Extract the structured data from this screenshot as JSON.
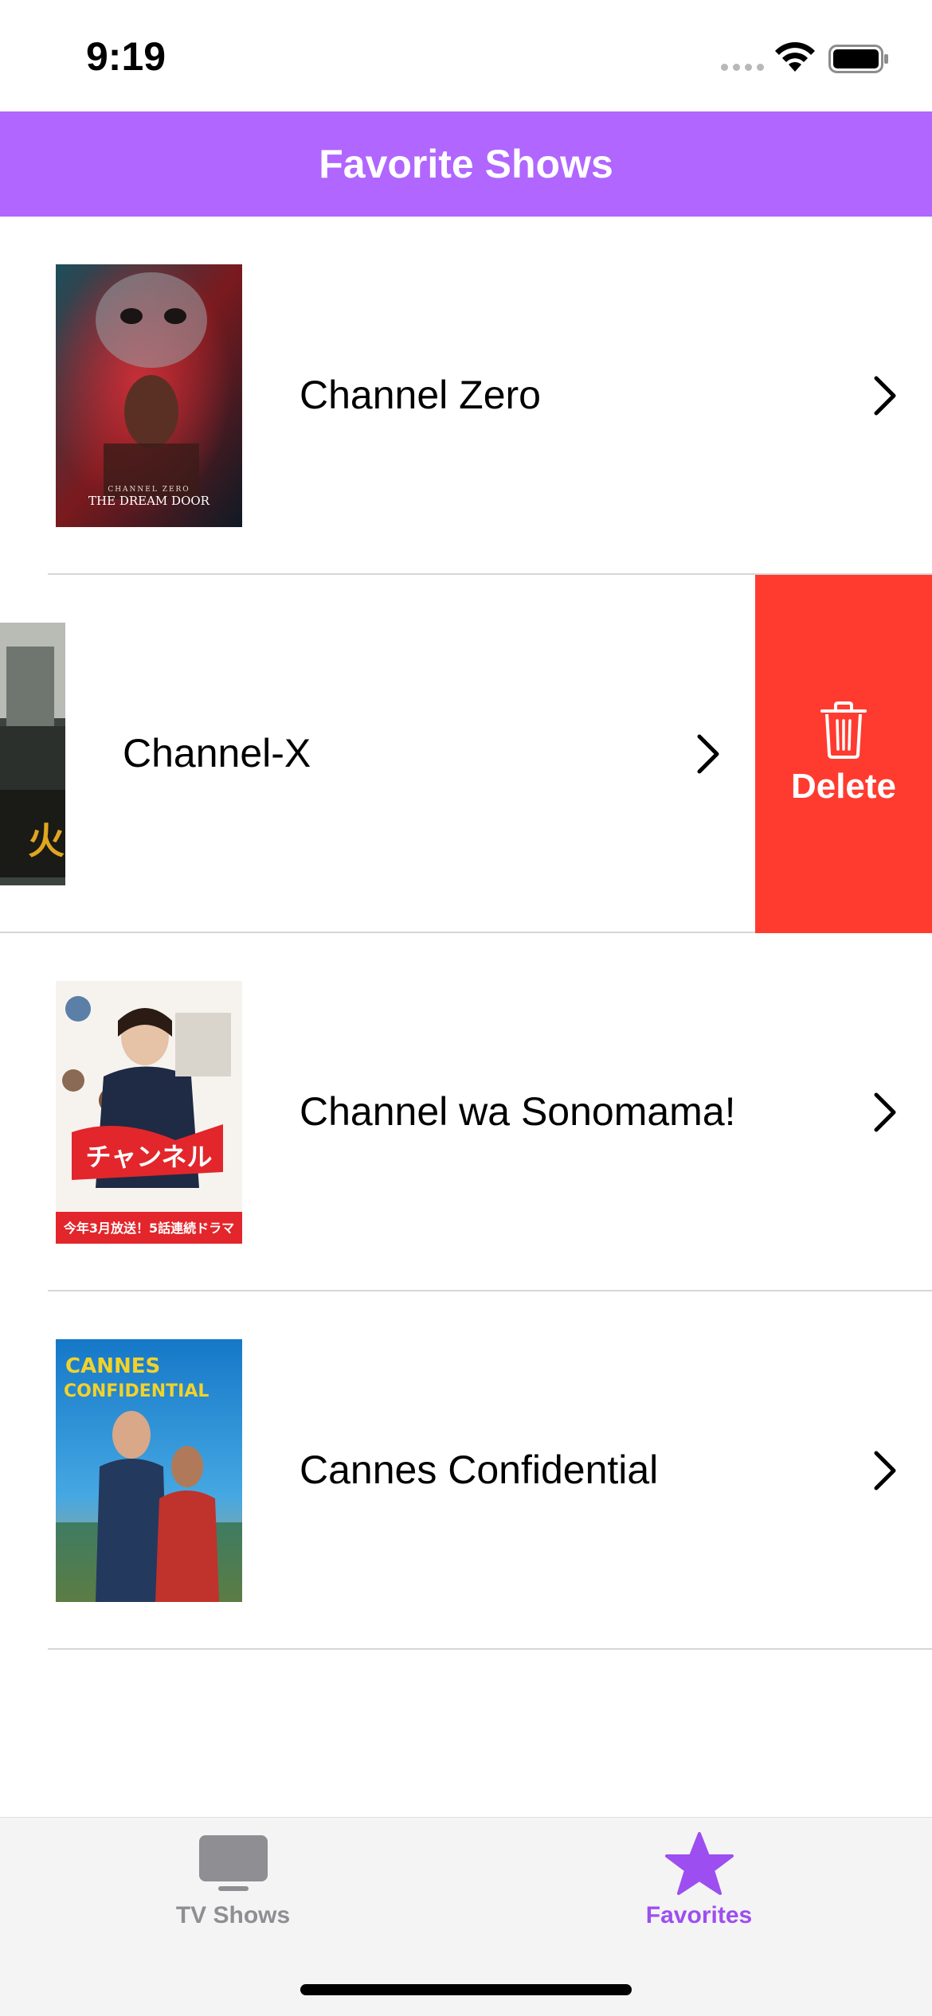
{
  "status_bar": {
    "time": "9:19"
  },
  "nav_bar": {
    "title": "Favorite Shows",
    "background_color": "#b066ff"
  },
  "shows": [
    {
      "title": "Channel Zero",
      "poster_text": "CHANNEL ZERO",
      "poster_subtext": "THE DREAM DOOR"
    },
    {
      "title": "Channel-X",
      "swiped": true,
      "action_label": "Delete"
    },
    {
      "title": "Channel wa Sonomama!"
    },
    {
      "title": "Cannes Confidential",
      "poster_text": "CANNES",
      "poster_subtext": "CONFIDENTIAL"
    }
  ],
  "delete_color": "#ff3b30",
  "tab_bar": {
    "tabs": [
      {
        "label": "TV Shows",
        "icon": "tv-icon",
        "selected": false,
        "color": "#8e8e93"
      },
      {
        "label": "Favorites",
        "icon": "star-icon",
        "selected": true,
        "color": "#9d4ef0"
      }
    ]
  }
}
